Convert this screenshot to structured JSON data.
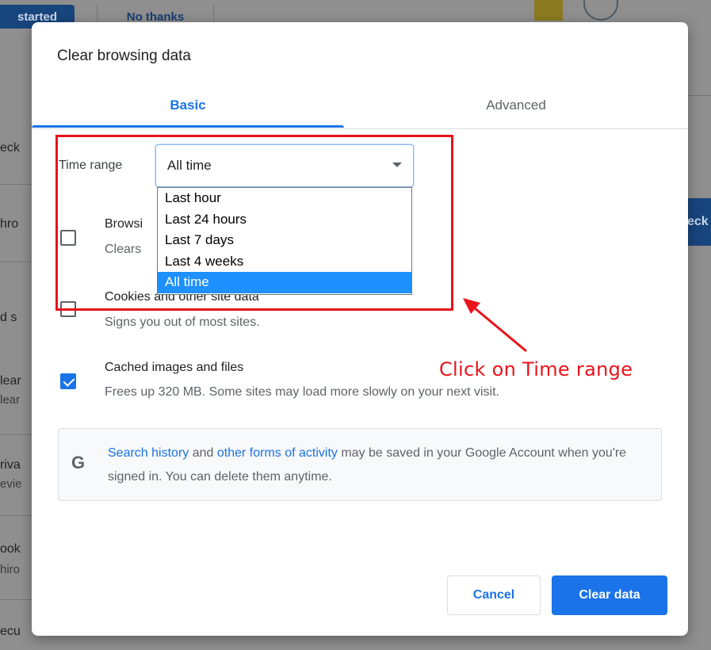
{
  "background": {
    "get_started_label": "started",
    "no_thanks_label": "No thanks",
    "right_fragment": "eck",
    "left_fragments": [
      "eck",
      "hro",
      "d s",
      "lear",
      "lear",
      "riva",
      "evie",
      "ook",
      "hiro",
      "ecu"
    ]
  },
  "dialog": {
    "title": "Clear browsing data",
    "tabs": [
      {
        "label": "Basic",
        "active": true
      },
      {
        "label": "Advanced",
        "active": false
      }
    ],
    "time_range": {
      "label": "Time range",
      "selected": "All time",
      "options": [
        "Last hour",
        "Last 24 hours",
        "Last 7 days",
        "Last 4 weeks",
        "All time"
      ]
    },
    "items": [
      {
        "title": "Browsi",
        "subtitle": "Clears",
        "checked": false
      },
      {
        "title": "Cookies and other site data",
        "subtitle": "Signs you out of most sites.",
        "checked": false
      },
      {
        "title": "Cached images and files",
        "subtitle": "Frees up 320 MB. Some sites may load more slowly on your next visit.",
        "checked": true
      }
    ],
    "info": {
      "icon": "G",
      "link1": "Search history",
      "text1": " and ",
      "link2": "other forms of activity",
      "text2": " may be saved in your Google Account when you're signed in. You can delete them anytime."
    },
    "buttons": {
      "cancel": "Cancel",
      "clear": "Clear data"
    }
  },
  "annotation": {
    "text": "Click on Time range",
    "color": "#e8131b"
  },
  "colors": {
    "accent": "#1a73e8",
    "selected_option": "#1e90ff"
  }
}
